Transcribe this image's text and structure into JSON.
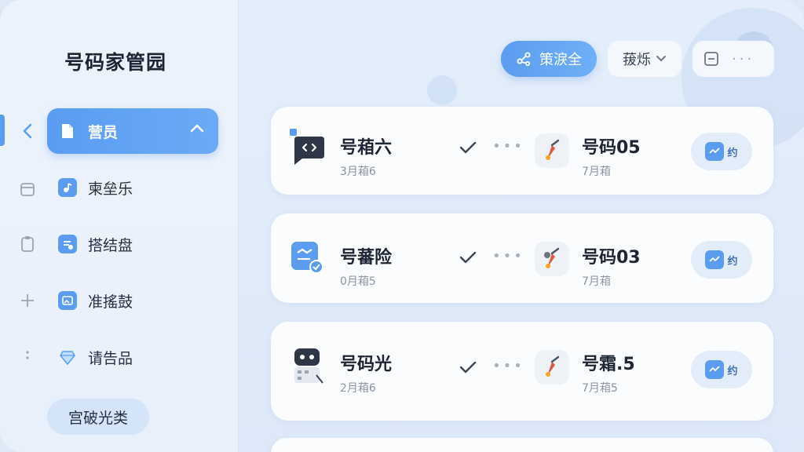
{
  "app": {
    "title": "号码家管园"
  },
  "sidebar": {
    "items": [
      {
        "label": "营员",
        "icon": "document-icon",
        "active": true
      },
      {
        "label": "柬垒乐",
        "icon": "music-note-icon",
        "active": false
      },
      {
        "label": "搭结盘",
        "icon": "checklist-icon",
        "active": false
      },
      {
        "label": "准搖鼓",
        "icon": "image-icon",
        "active": false
      },
      {
        "label": "请告品",
        "icon": "diamond-icon",
        "active": false
      }
    ],
    "bottom_button": "宫破光类"
  },
  "header": {
    "primary_label": "策淚全",
    "filter_label": "菝烁",
    "more_label": "···"
  },
  "cards": [
    {
      "src_name": "号葙六",
      "src_date": "3月葙6",
      "dst_name": "号码05",
      "dst_date": "7月葙",
      "action_label": "约"
    },
    {
      "src_name": "号蕃险",
      "src_date": "0月葙5",
      "dst_name": "号码03",
      "dst_date": "7月葙",
      "action_label": "约"
    },
    {
      "src_name": "号码光",
      "src_date": "2月葙6",
      "dst_name": "号霜.5",
      "dst_date": "7月葙5",
      "action_label": "约"
    }
  ],
  "colors": {
    "accent": "#5b9cf0",
    "background": "#dfe9f6",
    "card": "#fbfcfe",
    "text": "#1d2433",
    "muted": "#8b94a3"
  }
}
